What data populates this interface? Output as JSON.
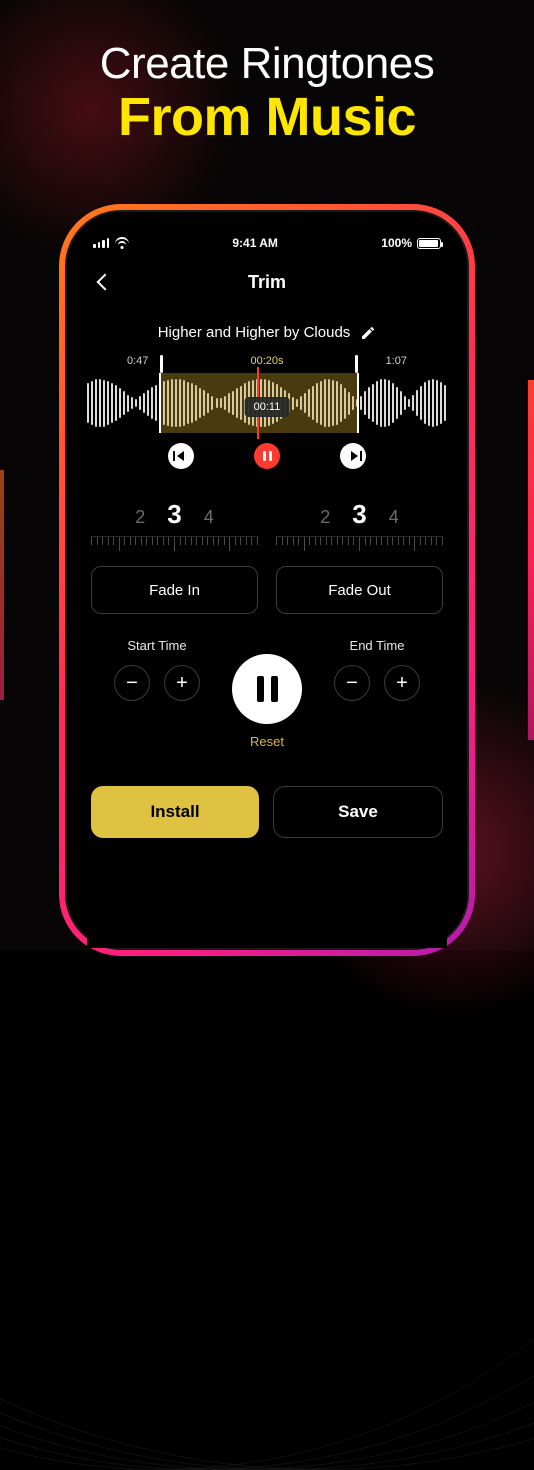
{
  "hero": {
    "line1": "Create Ringtones",
    "line2": "From Music"
  },
  "status": {
    "time": "9:41 AM",
    "battery_pct": "100%"
  },
  "nav": {
    "title": "Trim"
  },
  "track": {
    "title": "Higher and Higher by Clouds"
  },
  "waveform": {
    "start_label": "0:47",
    "end_label": "1:07",
    "selection_label": "00:20s",
    "playhead_label": "00:11"
  },
  "dials": {
    "left": {
      "prev": "2",
      "cur": "3",
      "next": "4"
    },
    "right": {
      "prev": "2",
      "cur": "3",
      "next": "4"
    }
  },
  "fade": {
    "in": "Fade In",
    "out": "Fade Out"
  },
  "times": {
    "start_title": "Start Time",
    "end_title": "End Time"
  },
  "buttons": {
    "reset": "Reset",
    "install": "Install",
    "save": "Save"
  },
  "colors": {
    "accent": "#e0c243",
    "danger": "#ff3b30"
  }
}
